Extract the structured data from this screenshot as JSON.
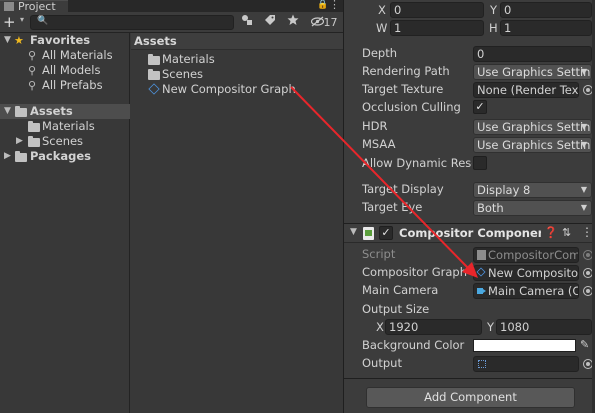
{
  "project": {
    "tab_title": "Project",
    "tab_lock": "🔒",
    "tab_menu": "⋮",
    "add_button": "+",
    "add_caret": "▾",
    "search_icon": "🔍",
    "toolbar_icons": [
      "scene-view-icon",
      "label-icon",
      "favorite-icon"
    ],
    "hidden_count": "17",
    "tree": {
      "favorites_label": "Favorites",
      "favorites": [
        "All Materials",
        "All Models",
        "All Prefabs"
      ],
      "assets_label": "Assets",
      "assets_children": [
        "Materials",
        "Scenes"
      ],
      "packages_label": "Packages"
    },
    "assets_header": "Assets",
    "asset_items": [
      "Materials",
      "Scenes",
      "New Compositor Graph"
    ]
  },
  "inspector": {
    "viewport": {
      "x_label": "X",
      "x_value": "0",
      "y_label": "Y",
      "y_value": "0",
      "w_label": "W",
      "w_value": "1",
      "h_label": "H",
      "h_value": "1"
    },
    "depth_label": "Depth",
    "depth_value": "0",
    "rendering_path_label": "Rendering Path",
    "rendering_path_value": "Use Graphics Settin",
    "target_texture_label": "Target Texture",
    "target_texture_value": "None (Render Textu",
    "occlusion_label": "Occlusion Culling",
    "occlusion_checked": "✓",
    "hdr_label": "HDR",
    "hdr_value": "Use Graphics Settin",
    "msaa_label": "MSAA",
    "msaa_value": "Use Graphics Settin",
    "dynamic_res_label": "Allow Dynamic Reso",
    "target_display_label": "Target Display",
    "target_display_value": "Display 8",
    "target_eye_label": "Target Eye",
    "target_eye_value": "Both",
    "component": {
      "check": "✓",
      "title": "Compositor Component (",
      "help_icon": "❓",
      "settings_icon": "⇅",
      "menu_icon": "⋮",
      "script_label": "Script",
      "script_value": "CompositorComp",
      "graph_label": "Compositor Graph A",
      "graph_value": "New Compositor",
      "camera_label": "Main Camera",
      "camera_value": "Main Camera (Ca",
      "output_size_label": "Output Size",
      "size_x_label": "X",
      "size_x_value": "1920",
      "size_y_label": "Y",
      "size_y_value": "1080",
      "bg_color_label": "Background Color",
      "bg_color": "#ffffff",
      "output_label": "Output"
    },
    "add_component_label": "Add Component"
  },
  "colors": {
    "drag_arrow": "#e8262b",
    "selection": "#4d4d4d",
    "accent_star": "#f0b91f"
  }
}
